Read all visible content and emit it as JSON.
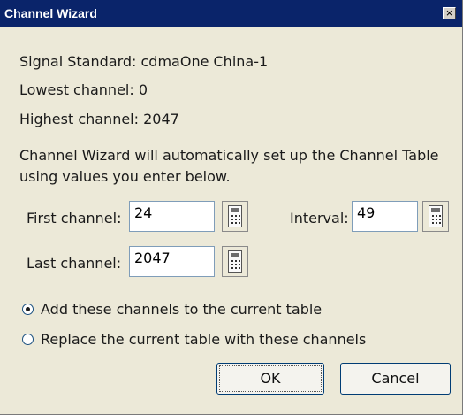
{
  "window": {
    "title": "Channel Wizard",
    "close_label": "×"
  },
  "info": {
    "signal_standard": "Signal Standard: cdmaOne China-1",
    "lowest": "Lowest channel: 0",
    "highest": "Highest channel: 2047"
  },
  "description": {
    "line1": "Channel Wizard will automatically set up the Channel Table",
    "line2": "using values you enter below."
  },
  "fields": {
    "first_label": "First channel:",
    "first_value": "24",
    "interval_label": "Interval:",
    "interval_value": "49",
    "last_label": "Last channel:",
    "last_value": "2047"
  },
  "options": {
    "add_label": "Add these channels to the current table",
    "replace_label": "Replace the current table with these channels",
    "selected": "add"
  },
  "buttons": {
    "ok": "OK",
    "cancel": "Cancel"
  },
  "icons": {
    "close": "close-icon",
    "calculator": "calculator-icon"
  },
  "colors": {
    "titlebar": "#0a246a",
    "face": "#ece9d8",
    "field_border": "#7f9db9"
  }
}
